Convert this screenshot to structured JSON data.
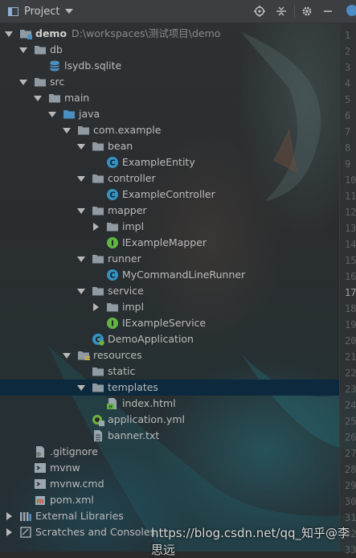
{
  "header": {
    "title": "Project"
  },
  "tab_icon_color": "#4c8cc4",
  "tree": [
    {
      "label": "demo",
      "path": "D:\\workspaces\\测试项目\\demo",
      "bold": true,
      "icon": "module-folder-icon",
      "expand": "down"
    },
    {
      "label": "db",
      "icon": "folder-icon",
      "expand": "down"
    },
    {
      "label": "lsydb.sqlite",
      "icon": "database-icon",
      "expand": "none"
    },
    {
      "label": "src",
      "icon": "folder-icon",
      "expand": "down"
    },
    {
      "label": "main",
      "icon": "folder-icon",
      "expand": "down"
    },
    {
      "label": "java",
      "icon": "source-folder-icon",
      "expand": "down"
    },
    {
      "label": "com.example",
      "icon": "package-icon",
      "expand": "down"
    },
    {
      "label": "bean",
      "icon": "package-icon",
      "expand": "down"
    },
    {
      "label": "ExampleEntity",
      "icon": "class-icon",
      "expand": "none"
    },
    {
      "label": "controller",
      "icon": "package-icon",
      "expand": "down"
    },
    {
      "label": "ExampleController",
      "icon": "class-icon",
      "expand": "none"
    },
    {
      "label": "mapper",
      "icon": "package-icon",
      "expand": "down"
    },
    {
      "label": "impl",
      "icon": "package-icon",
      "expand": "right"
    },
    {
      "label": "IExampleMapper",
      "icon": "interface-icon",
      "expand": "none"
    },
    {
      "label": "runner",
      "icon": "package-icon",
      "expand": "down"
    },
    {
      "label": "MyCommandLineRunner",
      "icon": "class-icon",
      "expand": "none"
    },
    {
      "label": "service",
      "icon": "package-icon",
      "expand": "down"
    },
    {
      "label": "impl",
      "icon": "package-icon",
      "expand": "right"
    },
    {
      "label": "IExampleService",
      "icon": "interface-icon",
      "expand": "none"
    },
    {
      "label": "DemoApplication",
      "icon": "spring-class-icon",
      "expand": "none"
    },
    {
      "label": "resources",
      "icon": "resources-folder-icon",
      "expand": "down"
    },
    {
      "label": "static",
      "icon": "folder-icon",
      "expand": "none"
    },
    {
      "label": "templates",
      "icon": "folder-icon",
      "expand": "down",
      "selected": true
    },
    {
      "label": "index.html",
      "icon": "html-file-icon",
      "expand": "none"
    },
    {
      "label": "application.yml",
      "icon": "yaml-file-icon",
      "expand": "none"
    },
    {
      "label": "banner.txt",
      "icon": "text-file-icon",
      "expand": "none"
    },
    {
      "label": ".gitignore",
      "icon": "gitignore-file-icon",
      "expand": "none"
    },
    {
      "label": "mvnw",
      "icon": "script-file-icon",
      "expand": "none"
    },
    {
      "label": "mvnw.cmd",
      "icon": "script-file-icon",
      "expand": "none"
    },
    {
      "label": "pom.xml",
      "icon": "maven-file-icon",
      "expand": "none"
    },
    {
      "label": "External Libraries",
      "icon": "libraries-icon",
      "expand": "right"
    },
    {
      "label": "Scratches and Consoles",
      "icon": "scratches-icon",
      "expand": "right"
    }
  ],
  "gutter_lines": [
    "1",
    "2",
    "3",
    "4",
    "5",
    "6",
    "7",
    "8",
    "9",
    "10",
    "11",
    "12",
    "13",
    "14",
    "15",
    "16",
    "17",
    "18",
    "19",
    "20",
    "21",
    "22",
    "23",
    "24",
    "25",
    "26",
    "27",
    "28",
    "29",
    "30",
    "31",
    "32",
    "33"
  ],
  "current_line": "17",
  "watermark": "https://blog.csdn.net/qq_知乎@李思远",
  "colors": {
    "folder": "#8f9aa3",
    "source_folder": "#4a8fbf",
    "class": "#3592c4",
    "interface": "#62b543",
    "selection": "#0d293e"
  }
}
